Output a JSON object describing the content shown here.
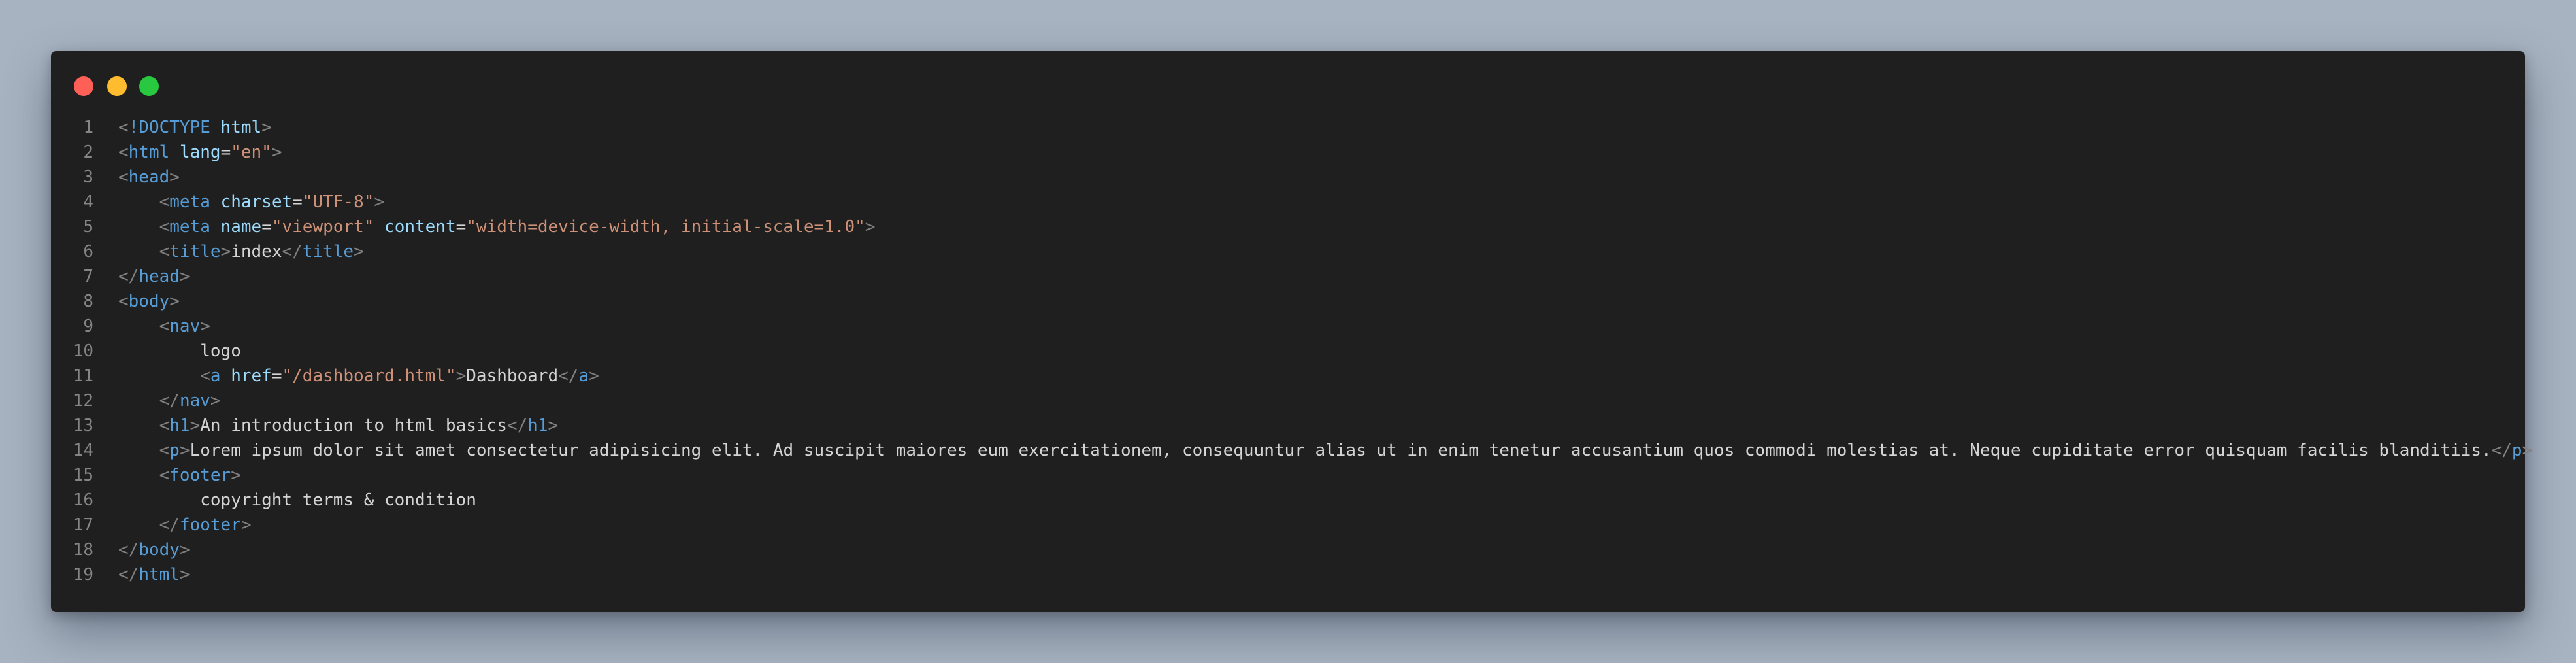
{
  "window": {
    "controls": {
      "close": "#fe5f57",
      "minimize": "#febc2e",
      "maximize": "#28c840"
    }
  },
  "colors": {
    "background": "#a8b3c1",
    "editor": "#1f1f1f",
    "line_number": "#858585",
    "punctuation": "#808080",
    "tag": "#569cd6",
    "attribute": "#9cdcfe",
    "string": "#ce9178",
    "text": "#d4d4d4"
  },
  "code": {
    "lines": [
      {
        "n": "1",
        "indent": "",
        "tokens": [
          {
            "t": "punct",
            "v": "<"
          },
          {
            "t": "tag",
            "v": "!DOCTYPE"
          },
          {
            "t": "txt",
            "v": " "
          },
          {
            "t": "attr",
            "v": "html"
          },
          {
            "t": "punct",
            "v": ">"
          }
        ]
      },
      {
        "n": "2",
        "indent": "",
        "tokens": [
          {
            "t": "punct",
            "v": "<"
          },
          {
            "t": "tag",
            "v": "html"
          },
          {
            "t": "txt",
            "v": " "
          },
          {
            "t": "attr",
            "v": "lang"
          },
          {
            "t": "txt",
            "v": "="
          },
          {
            "t": "val",
            "v": "\"en\""
          },
          {
            "t": "punct",
            "v": ">"
          }
        ]
      },
      {
        "n": "3",
        "indent": "",
        "tokens": [
          {
            "t": "punct",
            "v": "<"
          },
          {
            "t": "tag",
            "v": "head"
          },
          {
            "t": "punct",
            "v": ">"
          }
        ]
      },
      {
        "n": "4",
        "indent": "    ",
        "tokens": [
          {
            "t": "punct",
            "v": "<"
          },
          {
            "t": "tag",
            "v": "meta"
          },
          {
            "t": "txt",
            "v": " "
          },
          {
            "t": "attr",
            "v": "charset"
          },
          {
            "t": "txt",
            "v": "="
          },
          {
            "t": "val",
            "v": "\"UTF-8\""
          },
          {
            "t": "punct",
            "v": ">"
          }
        ]
      },
      {
        "n": "5",
        "indent": "    ",
        "tokens": [
          {
            "t": "punct",
            "v": "<"
          },
          {
            "t": "tag",
            "v": "meta"
          },
          {
            "t": "txt",
            "v": " "
          },
          {
            "t": "attr",
            "v": "name"
          },
          {
            "t": "txt",
            "v": "="
          },
          {
            "t": "val",
            "v": "\"viewport\""
          },
          {
            "t": "txt",
            "v": " "
          },
          {
            "t": "attr",
            "v": "content"
          },
          {
            "t": "txt",
            "v": "="
          },
          {
            "t": "val",
            "v": "\"width=device-width, initial-scale=1.0\""
          },
          {
            "t": "punct",
            "v": ">"
          }
        ]
      },
      {
        "n": "6",
        "indent": "    ",
        "tokens": [
          {
            "t": "punct",
            "v": "<"
          },
          {
            "t": "tag",
            "v": "title"
          },
          {
            "t": "punct",
            "v": ">"
          },
          {
            "t": "txt",
            "v": "index"
          },
          {
            "t": "punct",
            "v": "</"
          },
          {
            "t": "tag",
            "v": "title"
          },
          {
            "t": "punct",
            "v": ">"
          }
        ]
      },
      {
        "n": "7",
        "indent": "",
        "tokens": [
          {
            "t": "punct",
            "v": "</"
          },
          {
            "t": "tag",
            "v": "head"
          },
          {
            "t": "punct",
            "v": ">"
          }
        ]
      },
      {
        "n": "8",
        "indent": "",
        "tokens": [
          {
            "t": "punct",
            "v": "<"
          },
          {
            "t": "tag",
            "v": "body"
          },
          {
            "t": "punct",
            "v": ">"
          }
        ]
      },
      {
        "n": "9",
        "indent": "    ",
        "tokens": [
          {
            "t": "punct",
            "v": "<"
          },
          {
            "t": "tag",
            "v": "nav"
          },
          {
            "t": "punct",
            "v": ">"
          }
        ]
      },
      {
        "n": "10",
        "indent": "        ",
        "tokens": [
          {
            "t": "txt",
            "v": "logo"
          }
        ]
      },
      {
        "n": "11",
        "indent": "        ",
        "tokens": [
          {
            "t": "punct",
            "v": "<"
          },
          {
            "t": "tag",
            "v": "a"
          },
          {
            "t": "txt",
            "v": " "
          },
          {
            "t": "attr",
            "v": "href"
          },
          {
            "t": "txt",
            "v": "="
          },
          {
            "t": "val",
            "v": "\"/dashboard.html\""
          },
          {
            "t": "punct",
            "v": ">"
          },
          {
            "t": "txt",
            "v": "Dashboard"
          },
          {
            "t": "punct",
            "v": "</"
          },
          {
            "t": "tag",
            "v": "a"
          },
          {
            "t": "punct",
            "v": ">"
          }
        ]
      },
      {
        "n": "12",
        "indent": "    ",
        "tokens": [
          {
            "t": "punct",
            "v": "</"
          },
          {
            "t": "tag",
            "v": "nav"
          },
          {
            "t": "punct",
            "v": ">"
          }
        ]
      },
      {
        "n": "13",
        "indent": "    ",
        "tokens": [
          {
            "t": "punct",
            "v": "<"
          },
          {
            "t": "tag",
            "v": "h1"
          },
          {
            "t": "punct",
            "v": ">"
          },
          {
            "t": "txt",
            "v": "An introduction to html basics"
          },
          {
            "t": "punct",
            "v": "</"
          },
          {
            "t": "tag",
            "v": "h1"
          },
          {
            "t": "punct",
            "v": ">"
          }
        ]
      },
      {
        "n": "14",
        "indent": "    ",
        "tokens": [
          {
            "t": "punct",
            "v": "<"
          },
          {
            "t": "tag",
            "v": "p"
          },
          {
            "t": "punct",
            "v": ">"
          },
          {
            "t": "txt",
            "v": "Lorem ipsum dolor sit amet consectetur adipisicing elit. Ad suscipit maiores eum exercitationem, consequuntur alias ut in enim tenetur accusantium quos commodi molestias at. Neque cupiditate error quisquam facilis blanditiis."
          },
          {
            "t": "punct",
            "v": "</"
          },
          {
            "t": "tag",
            "v": "p"
          },
          {
            "t": "punct",
            "v": ">"
          }
        ]
      },
      {
        "n": "15",
        "indent": "    ",
        "tokens": [
          {
            "t": "punct",
            "v": "<"
          },
          {
            "t": "tag",
            "v": "footer"
          },
          {
            "t": "punct",
            "v": ">"
          }
        ]
      },
      {
        "n": "16",
        "indent": "        ",
        "tokens": [
          {
            "t": "txt",
            "v": "copyright terms & condition"
          }
        ]
      },
      {
        "n": "17",
        "indent": "    ",
        "tokens": [
          {
            "t": "punct",
            "v": "</"
          },
          {
            "t": "tag",
            "v": "footer"
          },
          {
            "t": "punct",
            "v": ">"
          }
        ]
      },
      {
        "n": "18",
        "indent": "",
        "tokens": [
          {
            "t": "punct",
            "v": "</"
          },
          {
            "t": "tag",
            "v": "body"
          },
          {
            "t": "punct",
            "v": ">"
          }
        ]
      },
      {
        "n": "19",
        "indent": "",
        "tokens": [
          {
            "t": "punct",
            "v": "</"
          },
          {
            "t": "tag",
            "v": "html"
          },
          {
            "t": "punct",
            "v": ">"
          }
        ]
      }
    ]
  }
}
